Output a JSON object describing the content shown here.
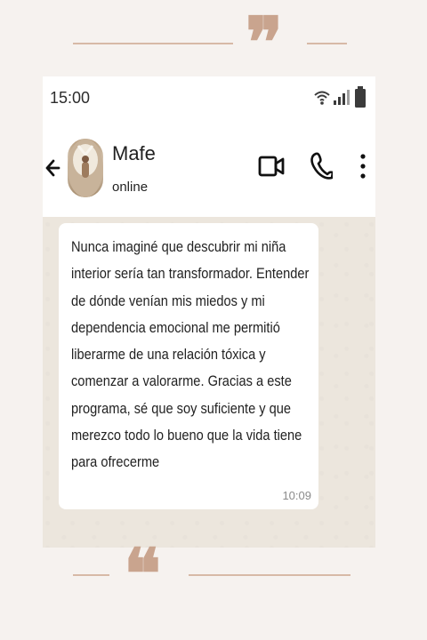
{
  "status_bar": {
    "time": "15:00"
  },
  "chat_header": {
    "contact_name": "Mafe",
    "contact_status": "online"
  },
  "message": {
    "text": "Nunca imaginé que descubrir mi niña interior sería tan transformador. Entender de dónde venían mis miedos y mi dependencia emocional me permitió liberarme de una relación tóxica y comenzar a valorarme. Gracias a este programa, sé que soy suficiente y que merezco todo lo bueno que la vida tiene para ofrecerme",
    "time": "10:09"
  },
  "decor": {
    "top_quote": "❞",
    "bottom_quote": "❝",
    "accent_color": "#c9a48e"
  },
  "icons": {
    "back": "arrow-left-icon",
    "video": "video-camera-icon",
    "call": "phone-icon",
    "menu": "more-vertical-icon",
    "wifi": "wifi-icon",
    "signal": "signal-icon",
    "battery": "battery-icon"
  }
}
